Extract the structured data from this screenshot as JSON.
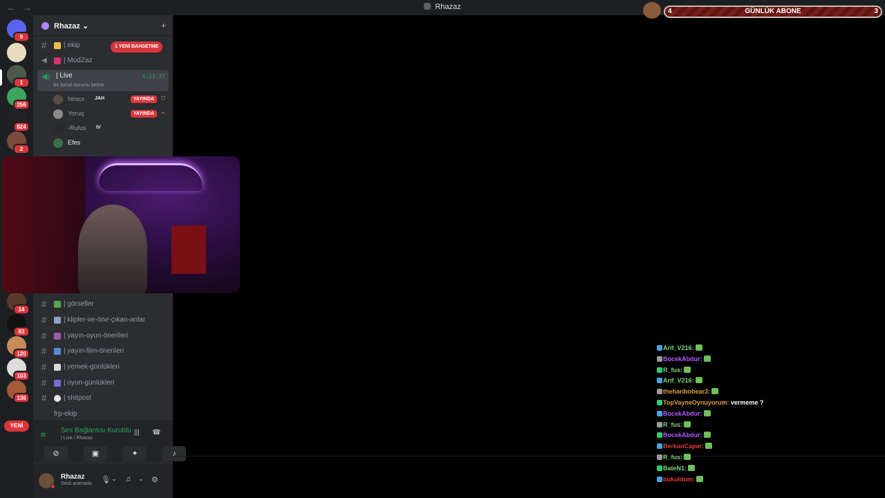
{
  "window": {
    "title": "Rhazaz",
    "nav_back": "←",
    "nav_forward": "→"
  },
  "servers": {
    "badges": [
      "9",
      "1",
      "256",
      "824",
      "2",
      "14",
      "83",
      "120",
      "103",
      "136"
    ],
    "new_pill": "YENİ"
  },
  "guild": {
    "name": "Rhazaz",
    "chevron": "⌄",
    "add_member_icon": "person-add-icon"
  },
  "channels_top": [
    {
      "label": "| ekip",
      "emoji_color": "#e8c04a"
    },
    {
      "label": "| ModZaz",
      "emoji_color": "#d6336c"
    }
  ],
  "mention_pill": "1 YENİ BAHSETME",
  "live_channel": {
    "label": "| Live",
    "time": "4:23:37",
    "status": "Bir kanal durumu belirle"
  },
  "voice_users": [
    {
      "name": "hirocx",
      "tag": "JAH",
      "live": "YAYINDA"
    },
    {
      "name": "Yoruq",
      "tag": "",
      "live": "YAYINDA"
    },
    {
      "name": "-Rufus",
      "tag": "IV",
      "live": ""
    },
    {
      "name": "Efes",
      "tag": "",
      "live": ""
    }
  ],
  "channels_bottom": [
    {
      "label": "| görseller",
      "emoji_color": "#57a64b"
    },
    {
      "label": "| klipler-ve-öne-çıkan-anlar",
      "emoji_color": "#8ea1c7"
    },
    {
      "label": "| yayın-oyun-önerileri",
      "emoji_color": "#9b59b6"
    },
    {
      "label": "| yayın-film-önerileri",
      "emoji_color": "#5b8bd6"
    },
    {
      "label": "| yemek-günlükleri",
      "emoji_color": "#d9d9d9"
    },
    {
      "label": "| oyun-günlükleri",
      "emoji_color": "#7a6cd6"
    },
    {
      "label": "| shitpost",
      "emoji_color": "#e6e6e6"
    }
  ],
  "channel_plain": "frp-ekip",
  "voice_panel": {
    "connected": "Ses Bağlantısı Kuruldu",
    "sub": "| Live / Rhazaz"
  },
  "user_panel": {
    "name": "Rhazaz",
    "status": "Sesli aramada"
  },
  "overlay": {
    "sub_left": "4",
    "sub_center": "GÜNLÜK ABONE",
    "sub_right": "3"
  },
  "chat": [
    {
      "user": "Arif_V216:",
      "color": "#7cd67c",
      "text": ""
    },
    {
      "user": "BocekAbdur:",
      "color": "#b05cff",
      "text": ""
    },
    {
      "user": "R_fus:",
      "color": "#7cd67c",
      "text": ""
    },
    {
      "user": "Arif_V216:",
      "color": "#7cd67c",
      "text": ""
    },
    {
      "user": "theharibobear3:",
      "color": "#e0a040",
      "text": ""
    },
    {
      "user": "TopVayneOynuyorum:",
      "color": "#e0a040",
      "text": "vermeme ?"
    },
    {
      "user": "BocekAbdur:",
      "color": "#b05cff",
      "text": ""
    },
    {
      "user": "R_fus:",
      "color": "#7cd67c",
      "text": ""
    },
    {
      "user": "BocekAbdur:",
      "color": "#b05cff",
      "text": ""
    },
    {
      "user": "BerkanCapar:",
      "color": "#e03b3b",
      "text": ""
    },
    {
      "user": "R_fus:",
      "color": "#7cd67c",
      "text": ""
    },
    {
      "user": "BateN1:",
      "color": "#7cd67c",
      "text": ""
    },
    {
      "user": "bukuldum:",
      "color": "#e03b3b",
      "text": ""
    }
  ]
}
